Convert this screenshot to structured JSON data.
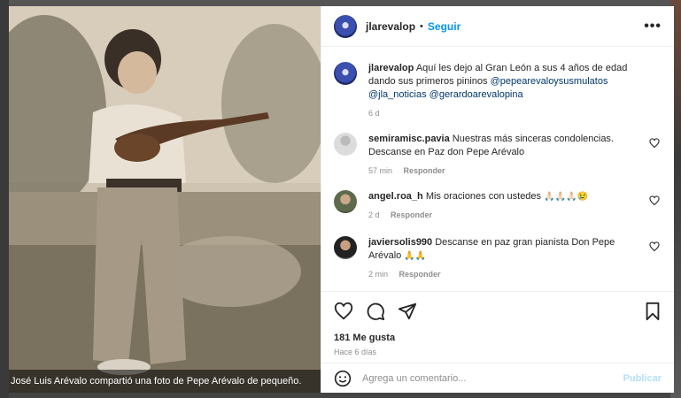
{
  "post": {
    "username": "jlarevalop",
    "separator": "•",
    "follow_label": "Seguir",
    "more_label": "•••",
    "caption_text": "Aquí les dejo al Gran León a sus 4 años de edad dando sus primeros pininos",
    "caption_mentions": [
      "@pepearevaloysusmulatos",
      "@jla_noticias",
      "@gerardoarevalopina"
    ],
    "caption_time": "6 d"
  },
  "comments": [
    {
      "user": "semiramisc.pavia",
      "text": "Nuestras más sinceras condolencias. Descanse en Paz don Pepe Arévalo",
      "time": "57 min",
      "reply": "Responder"
    },
    {
      "user": "angel.roa_h",
      "text": "Mis oraciones con ustedes",
      "emoji": "🙏🏻🙏🏻🙏🏻😢",
      "time": "2 d",
      "reply": "Responder"
    },
    {
      "user": "javiersolis990",
      "text": "Descanse en paz gran pianista Don Pepe Arévalo",
      "emoji": "🙏🙏",
      "time": "2 min",
      "reply": "Responder"
    }
  ],
  "actions": {
    "likes": "181 Me gusta",
    "posted": "Hace 6 días"
  },
  "composer": {
    "placeholder": "Agrega un comentario...",
    "publish_label": "Publicar"
  },
  "photo_caption": "José Luis Arévalo compartió una foto de Pepe Arévalo de pequeño.",
  "colors": {
    "accent": "#0095f6",
    "link": "#00376b",
    "muted": "#8e8e8e"
  }
}
